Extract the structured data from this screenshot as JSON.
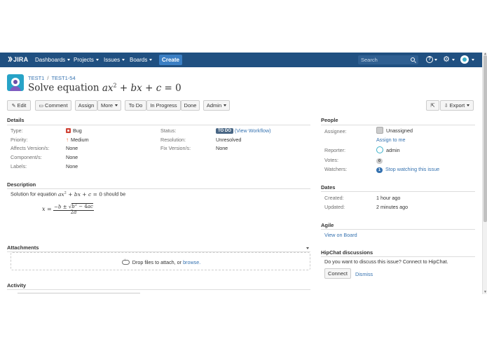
{
  "header": {
    "logo": "JIRA",
    "nav": [
      {
        "label": "Dashboards"
      },
      {
        "label": "Projects"
      },
      {
        "label": "Issues"
      },
      {
        "label": "Boards"
      }
    ],
    "create_label": "Create",
    "search_placeholder": "Search",
    "help_glyph": "?",
    "gear_glyph": "⚙"
  },
  "issue": {
    "project": "TEST1",
    "key": "TEST1-54",
    "summary_prefix": "Solve equation",
    "summary_latex": "ax^2 + bx + c = 0"
  },
  "toolbar": {
    "edit": "Edit",
    "comment": "Comment",
    "assign": "Assign",
    "more": "More",
    "todo": "To Do",
    "in_progress": "In Progress",
    "done": "Done",
    "admin": "Admin",
    "export": "Export"
  },
  "details": {
    "heading": "Details",
    "type_label": "Type:",
    "type_value": "Bug",
    "priority_label": "Priority:",
    "priority_value": "Medium",
    "affects_label": "Affects Version/s:",
    "affects_value": "None",
    "components_label": "Component/s:",
    "components_value": "None",
    "labels_label": "Labels:",
    "labels_value": "None",
    "status_label": "Status:",
    "status_value": "TO DO",
    "view_workflow": "(View Workflow)",
    "resolution_label": "Resolution:",
    "resolution_value": "Unresolved",
    "fix_label": "Fix Version/s:",
    "fix_value": "None"
  },
  "description": {
    "heading": "Description",
    "text_before": "Solution for equation",
    "text_after": "should be",
    "formula_latex": "x = \\frac{-b \\pm \\sqrt{b^2 - 4ac}}{2a}"
  },
  "attachments": {
    "heading": "Attachments",
    "drop_text": "Drop files to attach, or",
    "browse": "browse."
  },
  "activity": {
    "heading": "Activity"
  },
  "people": {
    "heading": "People",
    "assignee_label": "Assignee:",
    "assignee_value": "Unassigned",
    "assign_to_me": "Assign to me",
    "reporter_label": "Reporter:",
    "reporter_value": "admin",
    "votes_label": "Votes:",
    "votes_count": "0",
    "watchers_label": "Watchers:",
    "watchers_count": "1",
    "stop_watching": "Stop watching this issue"
  },
  "dates": {
    "heading": "Dates",
    "created_label": "Created:",
    "created_value": "1 hour ago",
    "updated_label": "Updated:",
    "updated_value": "2 minutes ago"
  },
  "agile": {
    "heading": "Agile",
    "view_on_board": "View on Board"
  },
  "hipchat": {
    "heading": "HipChat discussions",
    "prompt": "Do you want to discuss this issue? Connect to HipChat.",
    "connect": "Connect",
    "dismiss": "Dismiss"
  },
  "colors": {
    "header_bg": "#205081",
    "create_bg": "#3b7fc4",
    "link": "#3572b0",
    "bug": "#d04437",
    "priority": "#f15c22",
    "status_lozenge": "#4a6785"
  },
  "icons": [
    "jira-logo-icon",
    "search-icon",
    "help-icon",
    "gear-icon",
    "user-avatar-icon",
    "project-avatar-icon",
    "pencil-icon",
    "comment-icon",
    "share-icon",
    "export-icon",
    "bug-icon",
    "priority-medium-icon",
    "cloud-upload-icon",
    "collapse-caret-icon"
  ]
}
